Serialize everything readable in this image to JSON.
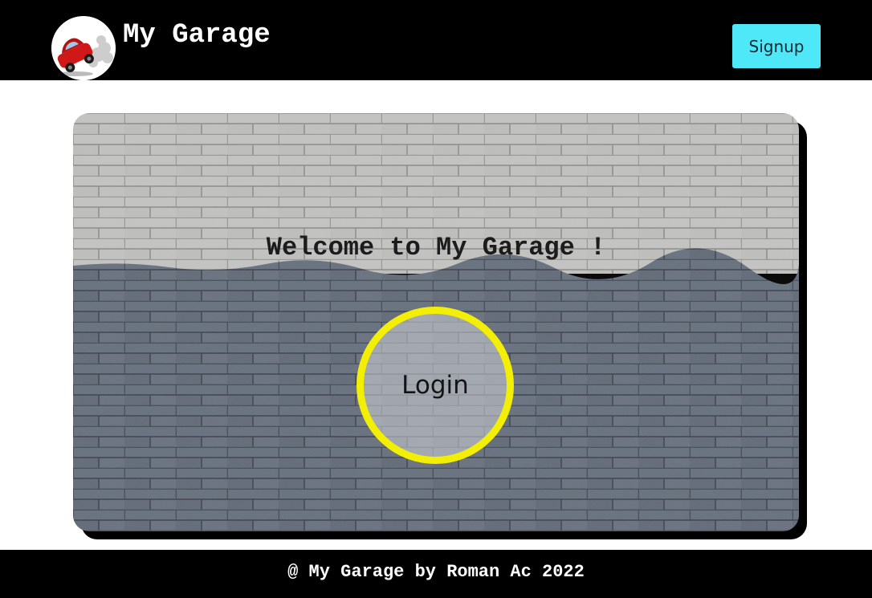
{
  "header": {
    "brand": "My Garage",
    "logo_icon": "red-car-logo-icon",
    "signup_label": "Signup",
    "signup_color": "#4ee8f8"
  },
  "hero": {
    "welcome": "Welcome to My Garage !",
    "login_label": "Login",
    "ring_color": "#f2ee05",
    "wall_top_color": "#b9b9b7",
    "wall_bottom_color": "#5c6470"
  },
  "footer": {
    "text": "@ My Garage by Roman Ac 2022"
  }
}
